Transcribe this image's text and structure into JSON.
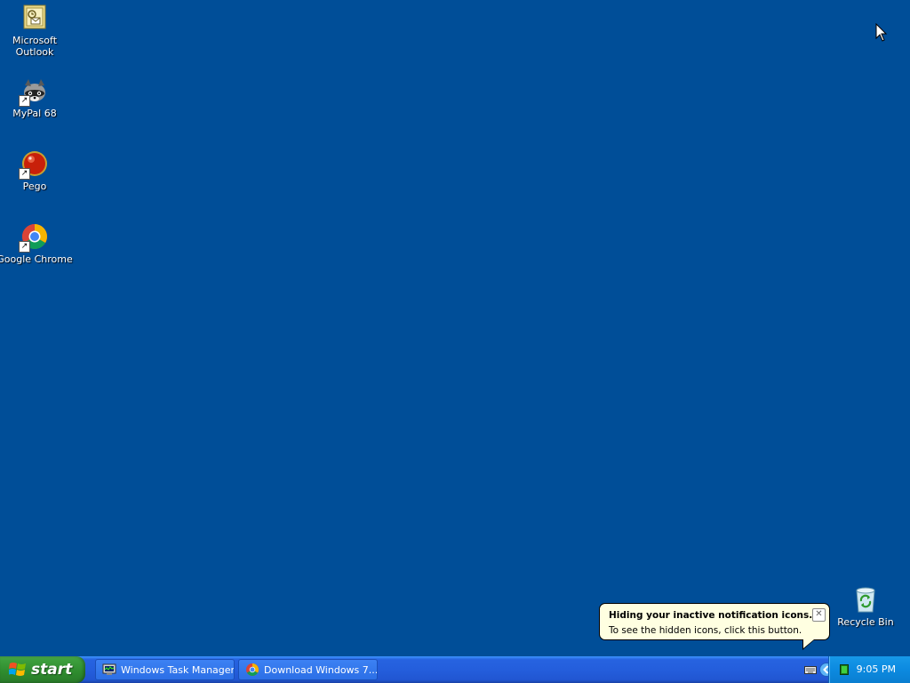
{
  "desktop": {
    "background_color": "#004E98",
    "icons": [
      {
        "label": "Microsoft Outlook",
        "icon": "outlook-icon"
      },
      {
        "label": "MyPal 68",
        "icon": "mypal-raccoon-icon"
      },
      {
        "label": "Pego",
        "icon": "pego-red-ball-icon"
      },
      {
        "label": "Google Chrome",
        "icon": "chrome-icon"
      },
      {
        "label": "Recycle Bin",
        "icon": "recycle-bin-icon"
      }
    ]
  },
  "balloon": {
    "title": "Hiding your inactive notification icons...",
    "text": "To see the hidden icons, click this button.",
    "close_symbol": "✕"
  },
  "taskbar": {
    "start_label": "start",
    "buttons": [
      {
        "label": "Windows Task Manager",
        "icon": "task-manager-icon"
      },
      {
        "label": "Download Windows 7...",
        "icon": "chrome-icon"
      }
    ],
    "tray": {
      "clock": "9:05 PM",
      "icons": [
        "keyboard-icon",
        "show-hidden-icons-chevron",
        "green-status-icon"
      ]
    }
  }
}
